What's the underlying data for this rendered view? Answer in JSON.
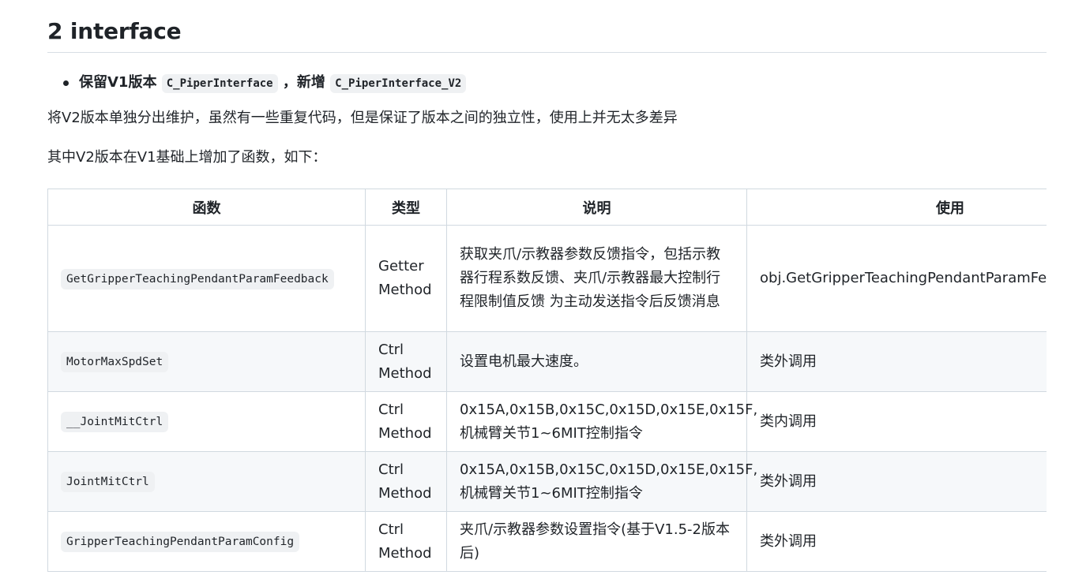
{
  "heading": "2 interface",
  "bullet": {
    "prefix": "保留V1版本",
    "code1": "C_PiperInterface",
    "middle": "，新增",
    "code2": "C_PiperInterface_V2"
  },
  "paragraph1": "将V2版本单独分出维护，虽然有一些重复代码，但是保证了版本之间的独立性，使用上并无太多差异",
  "paragraph2": "其中V2版本在V1基础上增加了函数，如下：",
  "table": {
    "headers": [
      "函数",
      "类型",
      "说明",
      "使用"
    ],
    "rows": [
      {
        "function": "GetGripperTeachingPendantParamFeedback",
        "type": "Getter Method",
        "description": "获取夹爪/示教器参数反馈指令，包括示教器行程系数反馈、夹爪/示教器最大控制行程限制值反馈 为主动发送指令后反馈消息",
        "usage": "obj.GetGripperTeachingPendantParamFeedback()"
      },
      {
        "function": "MotorMaxSpdSet",
        "type": "Ctrl Method",
        "description": "设置电机最大速度。",
        "usage": "类外调用"
      },
      {
        "function": "__JointMitCtrl",
        "type": "Ctrl Method",
        "description": "0x15A,0x15B,0x15C,0x15D,0x15E,0x15F,机械臂关节1~6MIT控制指令",
        "usage": "类内调用"
      },
      {
        "function": "JointMitCtrl",
        "type": "Ctrl Method",
        "description": "0x15A,0x15B,0x15C,0x15D,0x15E,0x15F,机械臂关节1~6MIT控制指令",
        "usage": "类外调用"
      },
      {
        "function": "GripperTeachingPendantParamConfig",
        "type": "Ctrl Method",
        "description": "夹爪/示教器参数设置指令(基于V1.5-2版本后)",
        "usage": "类外调用"
      }
    ]
  }
}
